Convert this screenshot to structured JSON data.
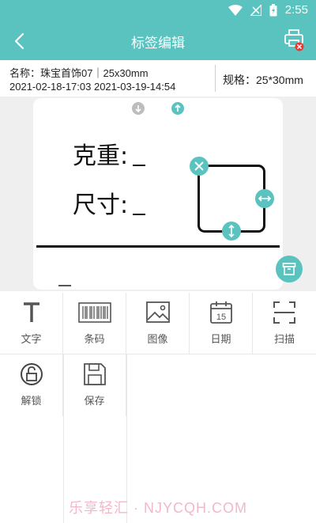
{
  "status_bar": {
    "time": "2:55"
  },
  "app_bar": {
    "title": "标签编辑"
  },
  "label_info": {
    "name": "名称：珠宝首饰07｜25x30mm",
    "dates": "2021-02-18-17:03 2021-03-19-14:54",
    "spec": "规格：25*30mm"
  },
  "canvas": {
    "text1": "克重:",
    "text2": "尺寸:"
  },
  "tools": [
    {
      "label": "文字",
      "icon": "text-icon"
    },
    {
      "label": "条码",
      "icon": "barcode-icon"
    },
    {
      "label": "图像",
      "icon": "image-icon"
    },
    {
      "label": "日期",
      "icon": "calendar-icon"
    },
    {
      "label": "扫描",
      "icon": "scan-icon"
    },
    {
      "label": "解锁",
      "icon": "unlock-icon"
    },
    {
      "label": "保存",
      "icon": "save-icon"
    }
  ],
  "calendar_day": "15",
  "watermark": "乐享轻汇 · NJYCQH.COM",
  "colors": {
    "accent": "#5bc3bf",
    "danger": "#e53935"
  }
}
